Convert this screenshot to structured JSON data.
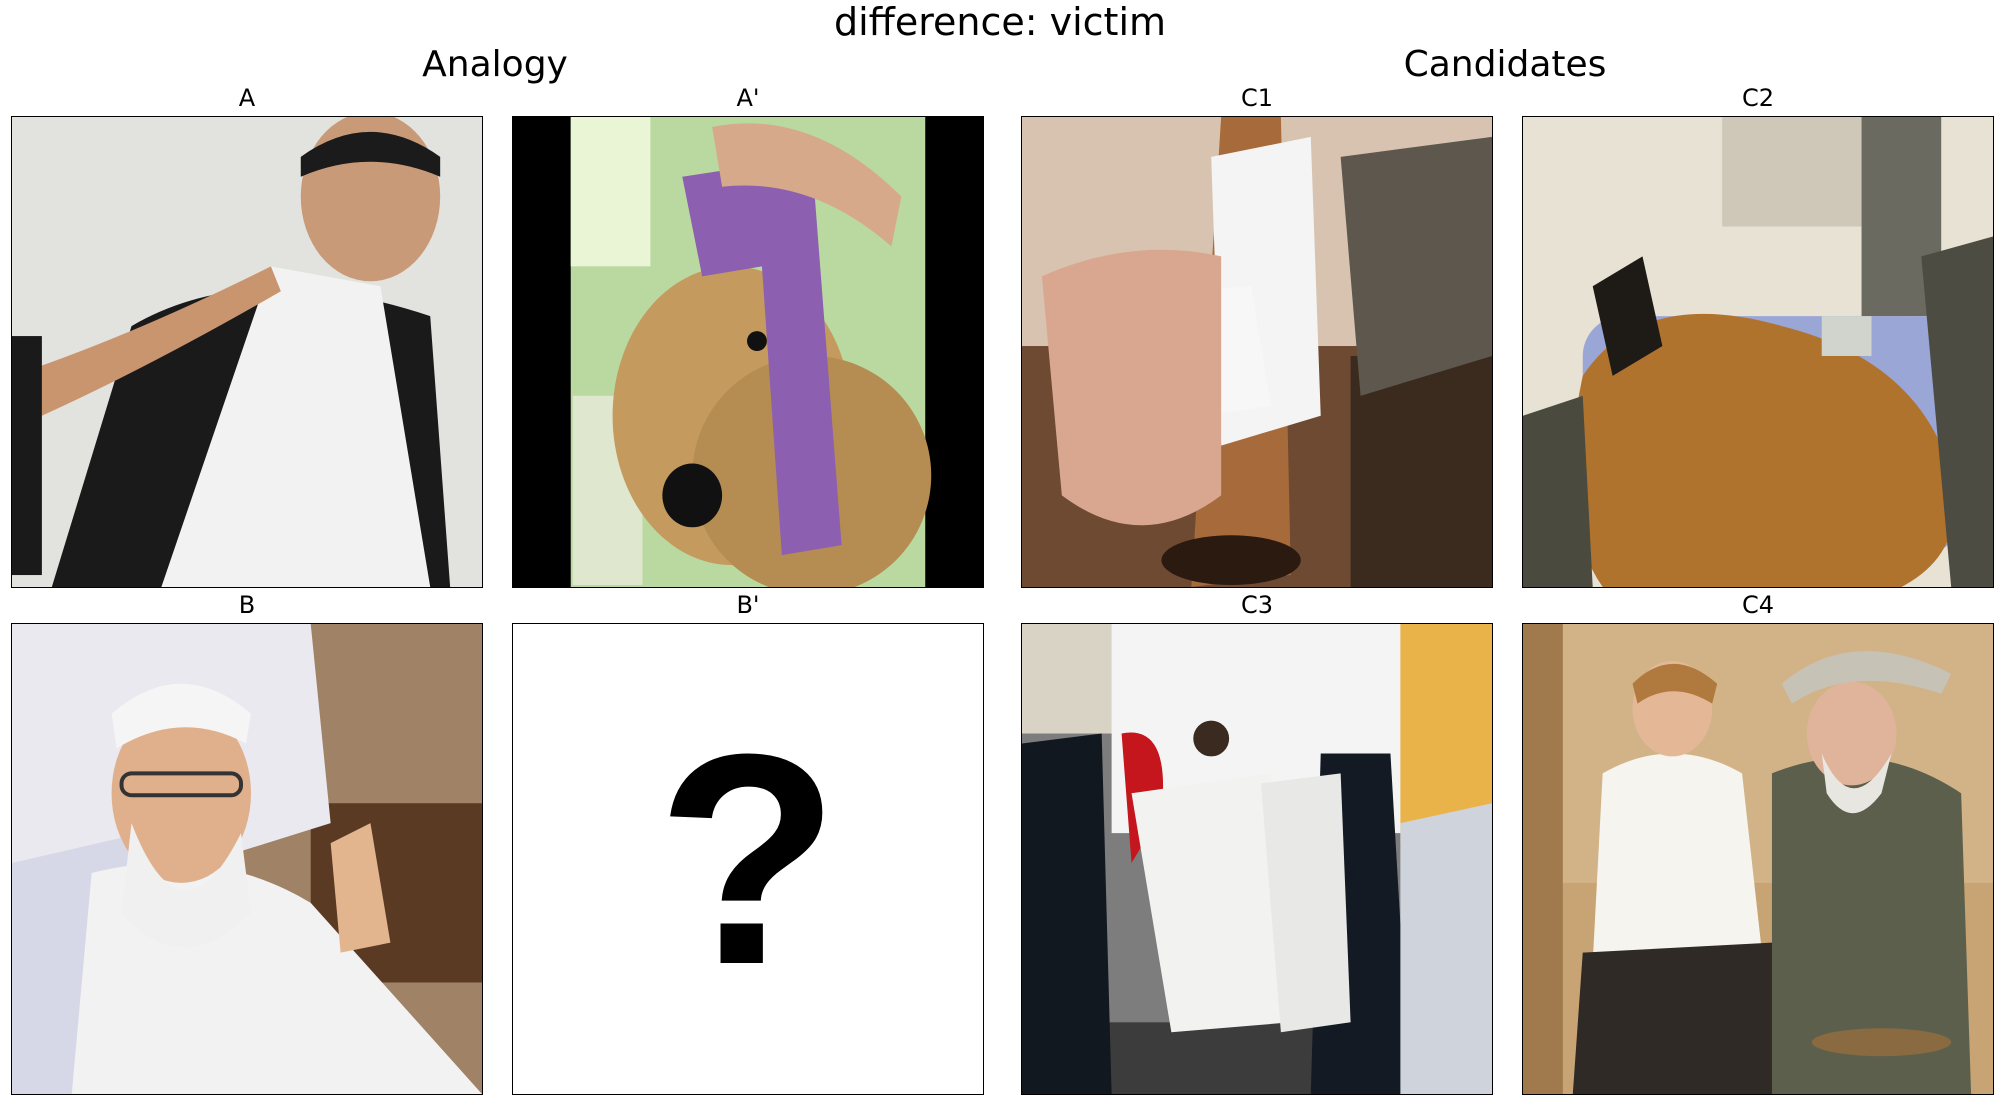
{
  "figure": {
    "title": "difference: victim",
    "sections": {
      "analogy": "Analogy",
      "candidates": "Candidates"
    },
    "panels": {
      "a": {
        "label": "A",
        "image": "man-with-white-sling-bandage"
      },
      "a_prime": {
        "label": "A'",
        "image": "plush-dog-with-purple-head-bandage"
      },
      "b": {
        "label": "B",
        "image": "elderly-man-in-hospital-bed"
      },
      "b_prime": {
        "label": "B'",
        "symbol": "?"
      },
      "c1": {
        "label": "C1",
        "image": "dog-leg-with-white-bandage"
      },
      "c2": {
        "label": "C2",
        "image": "dog-on-veterinary-table"
      },
      "c3": {
        "label": "C3",
        "image": "patient-on-stretcher-with-police"
      },
      "c4": {
        "label": "C4",
        "image": "young-man-treating-old-man-hand"
      }
    }
  }
}
